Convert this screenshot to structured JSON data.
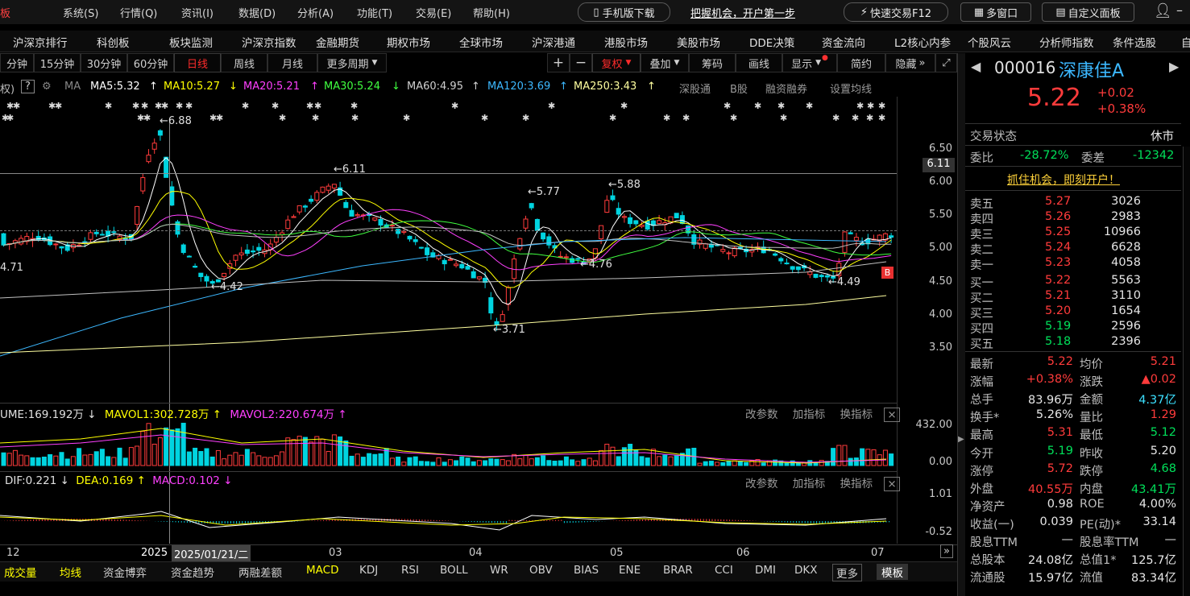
{
  "menu": {
    "app_glyph": "板",
    "items": [
      "系统(S)",
      "行情(Q)",
      "资讯(I)",
      "数据(D)",
      "分析(A)",
      "功能(T)",
      "交易(E)",
      "帮助(H)"
    ],
    "mobile": "手机版下载",
    "promo": "把握机会，开户第一步",
    "fast_trade": "快速交易F12",
    "multi_window": "多窗口",
    "custom_panel": "自定义面板"
  },
  "nav": {
    "items": [
      "沪深京排行",
      "科创板",
      "板块监测",
      "沪深京指数",
      "金融期货",
      "期权市场",
      "全球市场",
      "沪深港通",
      "港股市场",
      "美股市场",
      "DDE决策",
      "资金流向",
      "L2核心内参",
      "个股风云",
      "分析师指数",
      "条件选股",
      "自"
    ]
  },
  "period": {
    "items": [
      "分钟",
      "15分钟",
      "30分钟",
      "60分钟",
      "日线",
      "周线",
      "月线",
      "更多周期"
    ],
    "active": "日线"
  },
  "tools": {
    "plus": "+",
    "minus": "−",
    "fuquan": "复权",
    "overlay": "叠加",
    "chip": "筹码",
    "draw": "画线",
    "show": "显示",
    "simple": "简约",
    "hide": "隐藏"
  },
  "ma": {
    "prefix": "权)",
    "q": "?",
    "label": "MA",
    "ma5": "MA5:5.32",
    "ma10": "MA10:5.27",
    "ma20": "MA20:5.21",
    "ma30": "MA30:5.24",
    "ma60": "MA60:4.95",
    "ma120": "MA120:3.69",
    "ma250": "MA250:3.43",
    "shengutong": "深股通",
    "bgu": "B股",
    "margin": "融资融券",
    "setma": "设置均线"
  },
  "price_axis": [
    "6.50",
    "6.00",
    "5.50",
    "5.00",
    "4.50",
    "4.00",
    "3.50"
  ],
  "current_price_tag": "6.11",
  "annotations": {
    "high": "6.88",
    "p611": "6.11",
    "p577": "5.77",
    "p588": "5.88",
    "p442": "4.42",
    "p476": "4.76",
    "p449": "4.49",
    "p371": "3.71",
    "p471": "4.71"
  },
  "colors": {
    "up": "#ff3b3b",
    "down": "#00d4e0",
    "ma5": "#ffffff",
    "ma10": "#ffff00",
    "ma20": "#ff40ff",
    "ma30": "#40ff40",
    "ma60": "#c0c0c0",
    "ma120": "#3cb8ff",
    "ma250": "#ffffa0",
    "bg": "#000000"
  },
  "volume": {
    "vol": "UME:169.192万",
    "mavol1": "MAVOL1:302.728万",
    "mavol2": "MAVOL2:220.674万",
    "axis_top": "432.00",
    "axis_bottom": "0.00"
  },
  "macd": {
    "dif": "DIF:0.221",
    "dea": "DEA:0.169",
    "macd": "MACD:0.102",
    "axis_top": "1.01",
    "axis_bottom": "-0.52"
  },
  "panel_btns": {
    "change_param": "改参数",
    "add_ind": "加指标",
    "swap_ind": "换指标",
    "close": "×"
  },
  "date_axis": [
    "12",
    "2025",
    "2025/01/21/二",
    "03",
    "04",
    "05",
    "06",
    "07"
  ],
  "bottom_tabs": [
    "成交量",
    "均线",
    "资金博弈",
    "资金趋势",
    "两融差额",
    "MACD",
    "KDJ",
    "RSI",
    "BOLL",
    "WR",
    "OBV",
    "BIAS",
    "ENE",
    "BRAR",
    "CCI",
    "DMI",
    "DKX",
    "更多",
    "模板"
  ],
  "quote": {
    "code": "000016",
    "name": "深康佳A",
    "price": "5.22",
    "change": "+0.02",
    "pct": "+0.38%",
    "status_label": "交易状态",
    "status": "休市",
    "weibi_label": "委比",
    "weibi": "-28.72%",
    "weicha_label": "委差",
    "weicha": "-12342",
    "promo": "抓住机会，即刻开户！",
    "asks": [
      {
        "label": "卖五",
        "price": "5.27",
        "vol": "3026"
      },
      {
        "label": "卖四",
        "price": "5.26",
        "vol": "2983"
      },
      {
        "label": "卖三",
        "price": "5.25",
        "vol": "10966"
      },
      {
        "label": "卖二",
        "price": "5.24",
        "vol": "6628"
      },
      {
        "label": "卖一",
        "price": "5.23",
        "vol": "4058"
      }
    ],
    "bids": [
      {
        "label": "买一",
        "price": "5.22",
        "vol": "5563"
      },
      {
        "label": "买二",
        "price": "5.21",
        "vol": "3110"
      },
      {
        "label": "买三",
        "price": "5.20",
        "vol": "1654"
      },
      {
        "label": "买四",
        "price": "5.19",
        "vol": "2596"
      },
      {
        "label": "买五",
        "price": "5.18",
        "vol": "2396"
      }
    ],
    "stats": [
      {
        "l1": "最新",
        "v1": "5.22",
        "c1": "red",
        "l2": "均价",
        "v2": "5.21",
        "c2": "red"
      },
      {
        "l1": "涨幅",
        "v1": "+0.38%",
        "c1": "red",
        "l2": "涨跌",
        "v2": "▲0.02",
        "c2": "red"
      },
      {
        "l1": "总手",
        "v1": "83.96万",
        "c1": "white",
        "l2": "金额",
        "v2": "4.37亿",
        "c2": "cyan"
      },
      {
        "l1": "换手*",
        "v1": "5.26%",
        "c1": "white",
        "l2": "量比",
        "v2": "1.29",
        "c2": "red"
      },
      {
        "l1": "最高",
        "v1": "5.31",
        "c1": "red",
        "l2": "最低",
        "v2": "5.12",
        "c2": "green"
      },
      {
        "l1": "今开",
        "v1": "5.19",
        "c1": "green",
        "l2": "昨收",
        "v2": "5.20",
        "c2": "white"
      },
      {
        "l1": "涨停",
        "v1": "5.72",
        "c1": "red",
        "l2": "跌停",
        "v2": "4.68",
        "c2": "green"
      },
      {
        "l1": "外盘",
        "v1": "40.55万",
        "c1": "red",
        "l2": "内盘",
        "v2": "43.41万",
        "c2": "green"
      },
      {
        "l1": "净资产",
        "v1": "0.98",
        "c1": "white",
        "l2": "ROE",
        "v2": "4.00%",
        "c2": "white"
      },
      {
        "l1": "收益(一)",
        "v1": "0.039",
        "c1": "white",
        "l2": "PE(动)*",
        "v2": "33.14",
        "c2": "white"
      },
      {
        "l1": "股息TTM",
        "v1": "—",
        "c1": "white",
        "l2": "股息率TTM",
        "v2": "—",
        "c2": "white"
      },
      {
        "l1": "总股本",
        "v1": "24.08亿",
        "c1": "white",
        "l2": "总值1*",
        "v2": "125.7亿",
        "c2": "white"
      },
      {
        "l1": "流通股",
        "v1": "15.97亿",
        "c1": "white",
        "l2": "流值",
        "v2": "83.34亿",
        "c2": "white"
      }
    ]
  }
}
